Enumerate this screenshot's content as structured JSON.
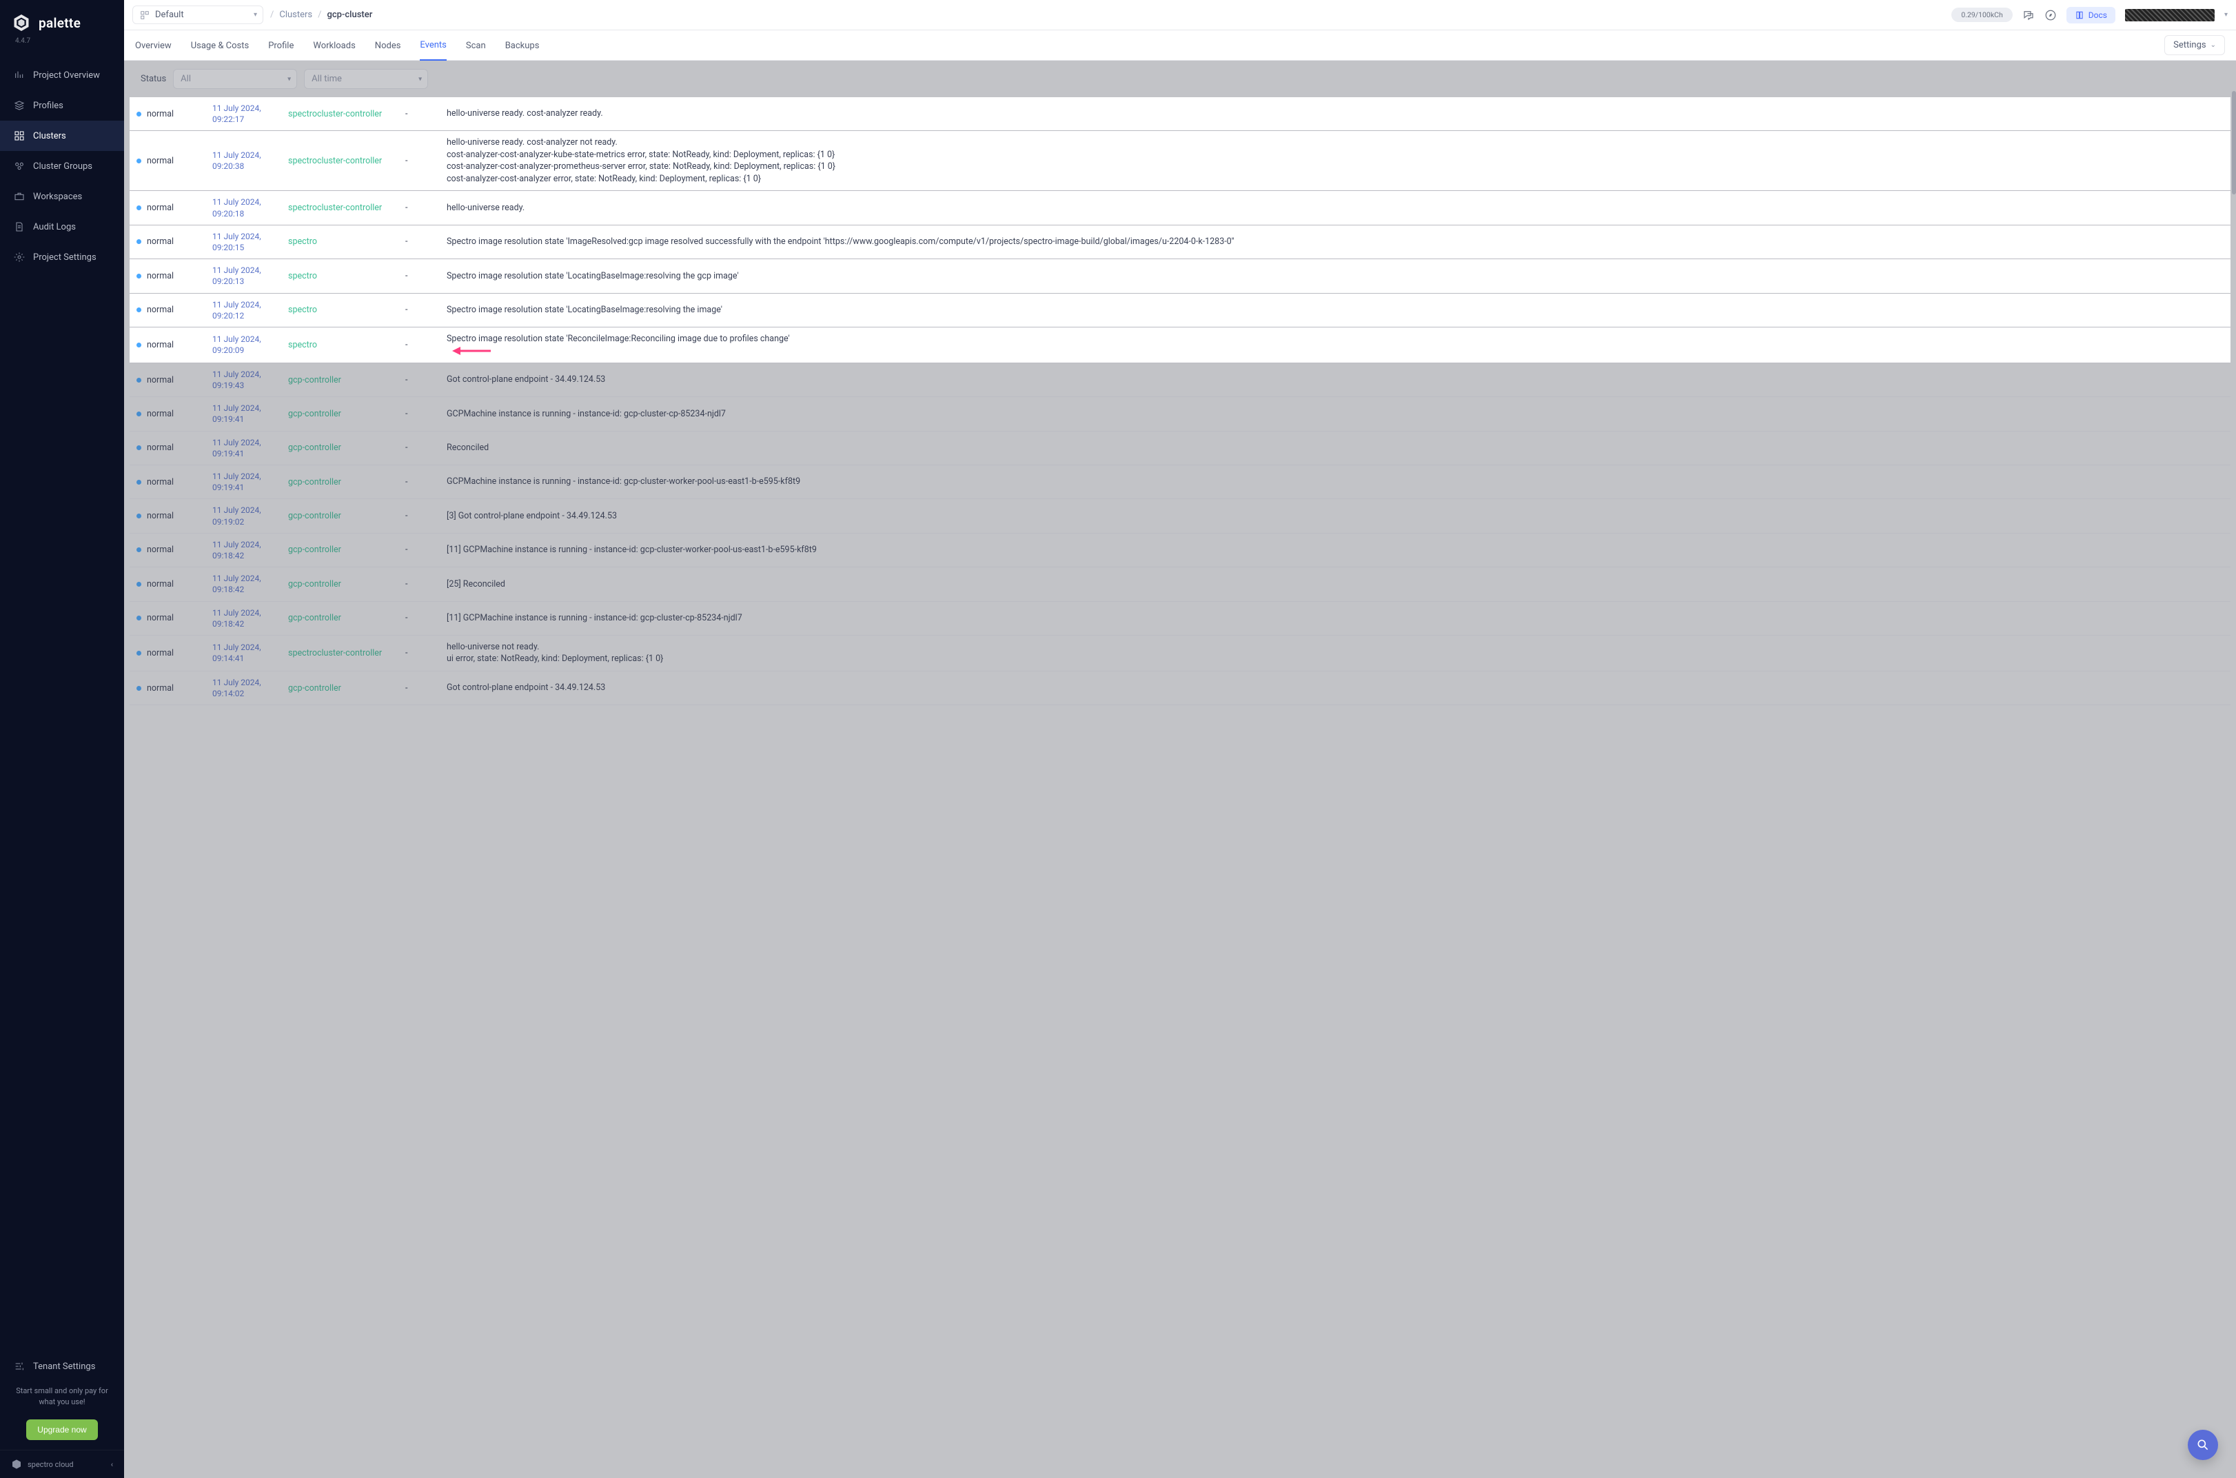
{
  "app": {
    "name": "palette",
    "version": "4.4.7"
  },
  "sidebar": {
    "items": [
      {
        "label": "Project Overview",
        "icon": "chart"
      },
      {
        "label": "Profiles",
        "icon": "stack"
      },
      {
        "label": "Clusters",
        "icon": "grid",
        "active": true
      },
      {
        "label": "Cluster Groups",
        "icon": "group"
      },
      {
        "label": "Workspaces",
        "icon": "briefcase"
      },
      {
        "label": "Audit Logs",
        "icon": "audit"
      },
      {
        "label": "Project Settings",
        "icon": "gear"
      }
    ],
    "tenant_settings": "Tenant Settings",
    "promo": "Start small and only pay for what you use!",
    "upgrade": "Upgrade now",
    "tenant_brand": "spectro cloud"
  },
  "topbar": {
    "project": "Default",
    "crumb_parent": "Clusters",
    "crumb_current": "gcp-cluster",
    "credit": "0.29/100kCh",
    "docs": "Docs"
  },
  "tabs": {
    "items": [
      "Overview",
      "Usage & Costs",
      "Profile",
      "Workloads",
      "Nodes",
      "Events",
      "Scan",
      "Backups"
    ],
    "active": "Events",
    "settings": "Settings"
  },
  "filters": {
    "status_label": "Status",
    "status_value": "All",
    "time_value": "All time"
  },
  "columns": {
    "status_text": "normal",
    "dash": "-"
  },
  "events": [
    {
      "hl": true,
      "time": "11 July 2024, 09:22:17",
      "src": "spectrocluster-controller",
      "msg": [
        "hello-universe ready. cost-analyzer ready."
      ]
    },
    {
      "hl": true,
      "time": "11 July 2024, 09:20:38",
      "src": "spectrocluster-controller",
      "msg": [
        "hello-universe ready. cost-analyzer not ready.",
        "cost-analyzer-cost-analyzer-kube-state-metrics error, state: NotReady, kind: Deployment, replicas: {1 0}",
        "cost-analyzer-cost-analyzer-prometheus-server error, state: NotReady, kind: Deployment, replicas: {1 0}",
        "cost-analyzer-cost-analyzer error, state: NotReady, kind: Deployment, replicas: {1 0}"
      ]
    },
    {
      "hl": true,
      "time": "11 July 2024, 09:20:18",
      "src": "spectrocluster-controller",
      "msg": [
        "hello-universe ready."
      ]
    },
    {
      "hl": true,
      "time": "11 July 2024, 09:20:15",
      "src": "spectro",
      "msg": [
        "Spectro image resolution state 'ImageResolved:gcp image resolved successfully with the endpoint 'https://www.googleapis.com/compute/v1/projects/spectro-image-build/global/images/u-2204-0-k-1283-0''"
      ]
    },
    {
      "hl": true,
      "time": "11 July 2024, 09:20:13",
      "src": "spectro",
      "msg": [
        "Spectro image resolution state 'LocatingBaseImage:resolving the gcp image'"
      ]
    },
    {
      "hl": true,
      "time": "11 July 2024, 09:20:12",
      "src": "spectro",
      "msg": [
        "Spectro image resolution state 'LocatingBaseImage:resolving the image'"
      ]
    },
    {
      "hl": true,
      "arrow": true,
      "time": "11 July 2024, 09:20:09",
      "src": "spectro",
      "msg": [
        "Spectro image resolution state 'ReconcileImage:Reconciling image due to profiles change'"
      ]
    },
    {
      "time": "11 July 2024, 09:19:43",
      "src": "gcp-controller",
      "msg": [
        "Got control-plane endpoint - 34.49.124.53"
      ]
    },
    {
      "time": "11 July 2024, 09:19:41",
      "src": "gcp-controller",
      "msg": [
        "GCPMachine instance is running - instance-id: gcp-cluster-cp-85234-njdl7"
      ]
    },
    {
      "time": "11 July 2024, 09:19:41",
      "src": "gcp-controller",
      "msg": [
        "Reconciled"
      ]
    },
    {
      "time": "11 July 2024, 09:19:41",
      "src": "gcp-controller",
      "msg": [
        "GCPMachine instance is running - instance-id: gcp-cluster-worker-pool-us-east1-b-e595-kf8t9"
      ]
    },
    {
      "time": "11 July 2024, 09:19:02",
      "src": "gcp-controller",
      "msg": [
        "[3] Got control-plane endpoint - 34.49.124.53"
      ]
    },
    {
      "time": "11 July 2024, 09:18:42",
      "src": "gcp-controller",
      "msg": [
        "[11] GCPMachine instance is running - instance-id: gcp-cluster-worker-pool-us-east1-b-e595-kf8t9"
      ]
    },
    {
      "time": "11 July 2024, 09:18:42",
      "src": "gcp-controller",
      "msg": [
        "[25] Reconciled"
      ]
    },
    {
      "time": "11 July 2024, 09:18:42",
      "src": "gcp-controller",
      "msg": [
        "[11] GCPMachine instance is running - instance-id: gcp-cluster-cp-85234-njdl7"
      ]
    },
    {
      "time": "11 July 2024, 09:14:41",
      "src": "spectrocluster-controller",
      "msg": [
        "hello-universe not ready.",
        "ui error, state: NotReady, kind: Deployment, replicas: {1 0}"
      ]
    },
    {
      "time": "11 July 2024, 09:14:02",
      "src": "gcp-controller",
      "msg": [
        "Got control-plane endpoint - 34.49.124.53"
      ]
    }
  ],
  "colors": {
    "accent": "#3e6df5",
    "success": "#3fbf97",
    "highlight_arrow": "#ff3d7f"
  }
}
